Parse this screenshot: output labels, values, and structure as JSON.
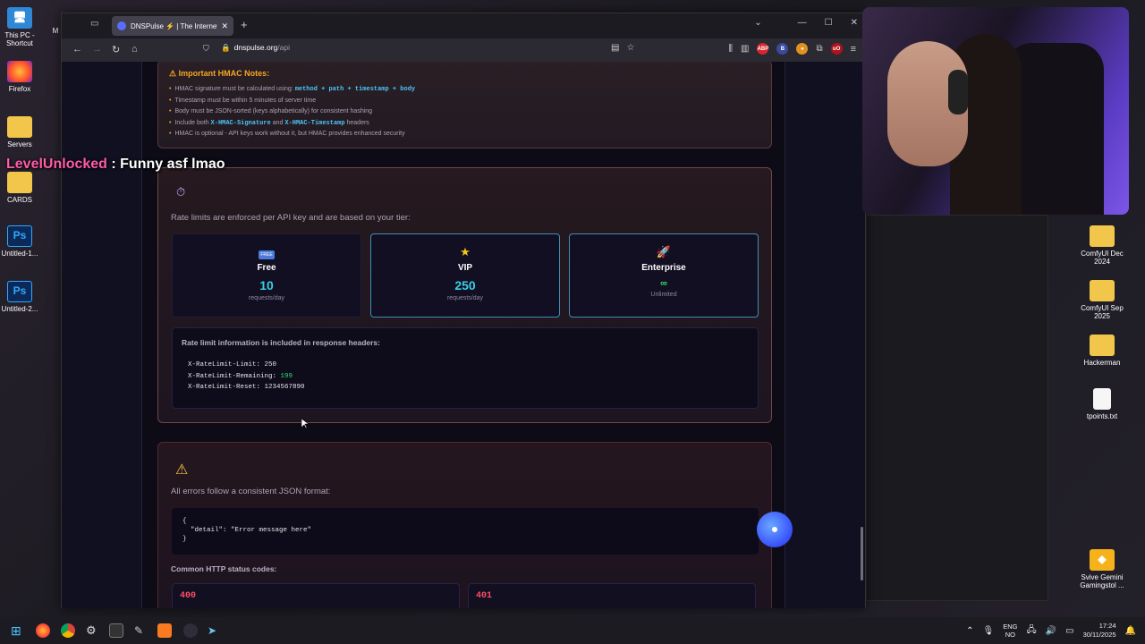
{
  "desktop": {
    "left_icons": [
      {
        "label": "This PC -\nShortcut",
        "icon": "computer-icon"
      },
      {
        "label": "Firefox",
        "icon": "firefox-icon"
      },
      {
        "label": "Servers",
        "icon": "folder-icon"
      },
      {
        "label": "CARDS",
        "icon": "folder-icon"
      },
      {
        "label": "Untitled-1...",
        "icon": "psd-icon"
      },
      {
        "label": "Untitled-2...",
        "icon": "psd-icon"
      }
    ],
    "right_icons": [
      {
        "label": "ComfyUI Dec 2024",
        "icon": "folder-icon"
      },
      {
        "label": "ComfyUI Sep 2025",
        "icon": "folder-icon"
      },
      {
        "label": "Hackerman",
        "icon": "folder-icon"
      },
      {
        "label": "tpoints.txt",
        "icon": "text-file-icon"
      },
      {
        "label": "Svive Gemini Gamingstol ...",
        "icon": "gemini-icon"
      }
    ],
    "partial_label": "M"
  },
  "browser": {
    "tab_title": "DNSPulse ⚡ | The Internet's Nerve",
    "url_host": "dnspulse.org",
    "url_path": "/api",
    "extensions": [
      {
        "text": "ABP",
        "color": "#d9262e"
      },
      {
        "text": "B",
        "color": "#3b4a9c"
      },
      {
        "text": "●",
        "color": "#e0921f"
      },
      {
        "text": "uO",
        "color": "#b0131b"
      }
    ]
  },
  "hmac": {
    "title": "Important HMAC Notes:",
    "notes": [
      {
        "pre": "HMAC signature must be calculated using: ",
        "code": "method + path + timestamp + body",
        "post": ""
      },
      {
        "pre": "Timestamp must be within 5 minutes of server time",
        "code": "",
        "post": ""
      },
      {
        "pre": "Body must be JSON-sorted (keys alphabetically) for consistent hashing",
        "code": "",
        "post": ""
      },
      {
        "pre": "Include both ",
        "code": "X-HMAC-Signature",
        "mid": " and ",
        "code2": "X-HMAC-Timestamp",
        "post": " headers"
      },
      {
        "pre": "HMAC is optional - API keys work without it, but HMAC provides enhanced security",
        "code": "",
        "post": ""
      }
    ]
  },
  "rate_limits": {
    "intro": "Rate limits are enforced per API key and are based on your tier:",
    "tiers": [
      {
        "name": "Free",
        "value": "10",
        "unit": "requests/day",
        "icon": "free-badge-icon"
      },
      {
        "name": "VIP",
        "value": "250",
        "unit": "requests/day",
        "icon": "star-icon"
      },
      {
        "name": "Enterprise",
        "value": "∞",
        "unit": "Unlimited",
        "icon": "rocket-icon"
      }
    ],
    "headers_title": "Rate limit information is included in response headers:",
    "headers": [
      {
        "key": "X-RateLimit-Limit: ",
        "value": "250"
      },
      {
        "key": "X-RateLimit-Remaining: ",
        "value": "199"
      },
      {
        "key": "X-RateLimit-Reset: ",
        "value": "1234567890"
      }
    ]
  },
  "errors": {
    "intro": "All errors follow a consistent JSON format:",
    "json_open": "{",
    "json_line": "\"detail\": \"Error message here\"",
    "json_close": "}",
    "codes_title": "Common HTTP status codes:",
    "codes": [
      "400",
      "401"
    ]
  },
  "chat": {
    "user": "LevelUnlocked",
    "message": " : Funny asf lmao"
  },
  "taskbar": {
    "lang_top": "ENG",
    "lang_bottom": "NO",
    "time": "17:24",
    "date": "30/11/2025"
  }
}
